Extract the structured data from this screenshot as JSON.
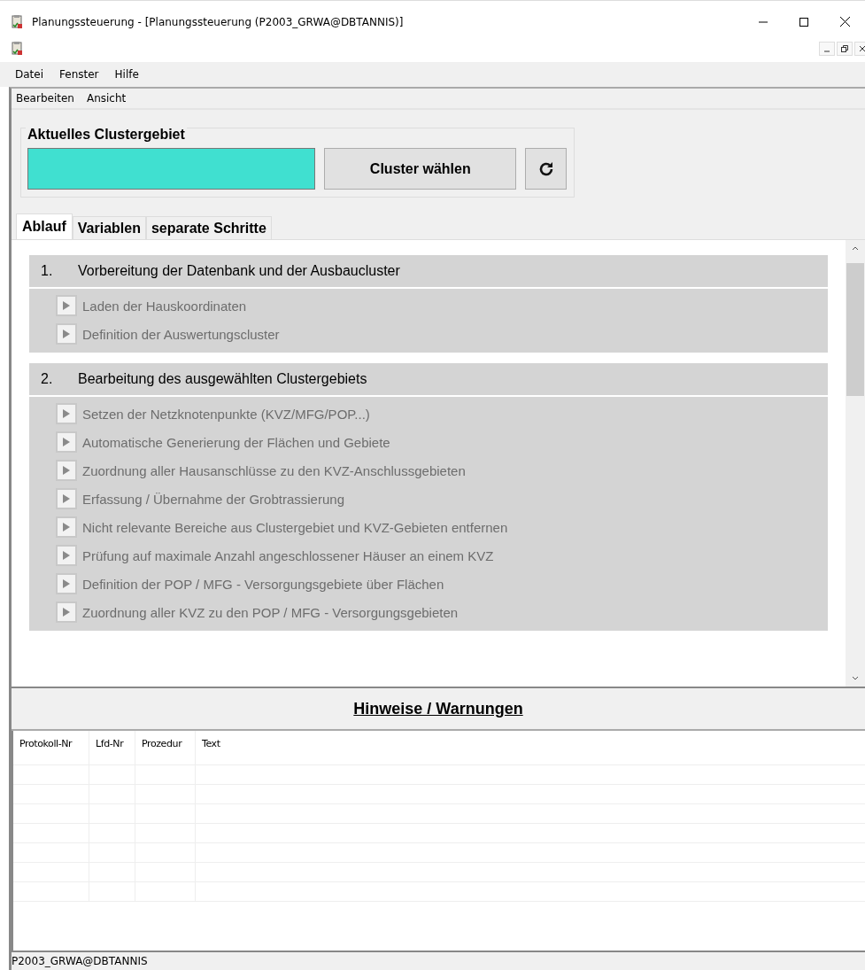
{
  "window": {
    "title": "Planungssteuerung - [Planungssteuerung (P2003_GRWA@DBTANNIS)]"
  },
  "menu": [
    "Datei",
    "Fenster",
    "Hilfe"
  ],
  "child_menu": [
    "Bearbeiten",
    "Ansicht"
  ],
  "cluster_group": {
    "title": "Aktuelles Clustergebiet",
    "button": "Cluster wählen"
  },
  "tabs": [
    {
      "label": "Ablauf",
      "selected": true
    },
    {
      "label": "Variablen",
      "selected": false
    },
    {
      "label": "separate Schritte",
      "selected": false
    }
  ],
  "sections": [
    {
      "number": "1.",
      "title": "Vorbereitung der Datenbank und der Ausbaucluster",
      "steps": [
        {
          "label": "Laden der Hauskoordinaten",
          "disabled": true
        },
        {
          "label": "Definition der Auswertungscluster",
          "disabled": true
        }
      ]
    },
    {
      "number": "2.",
      "title": "Bearbeitung des ausgewählten Clustergebiets",
      "steps": [
        {
          "label": "Setzen der Netzknotenpunkte (KVZ/MFG/POP...)",
          "disabled": true
        },
        {
          "label": "Automatische Generierung der Flächen und Gebiete",
          "disabled": true
        },
        {
          "label": "Zuordnung aller Hausanschlüsse zu den KVZ-Anschlussgebieten",
          "disabled": true
        },
        {
          "label": "Erfassung / Übernahme der Grobtrassierung",
          "disabled": true
        },
        {
          "label": "Nicht relevante Bereiche aus Clustergebiet und KVZ-Gebieten entfernen",
          "disabled": true
        },
        {
          "label": "Prüfung auf maximale Anzahl angeschlossener Häuser an einem KVZ",
          "disabled": true
        },
        {
          "label": "Definition der POP / MFG - Versorgungsgebiete über Flächen",
          "disabled": true
        },
        {
          "label": "Zuordnung aller KVZ zu den POP / MFG - Versorgungsgebieten",
          "disabled": true
        }
      ]
    }
  ],
  "warnings": {
    "title": "Hinweise / Warnungen",
    "columns": [
      "Protokoll-Nr",
      "Lfd-Nr",
      "Prozedur",
      "Text"
    ]
  },
  "status_bar": "P2003_GRWA@DBTANNIS"
}
